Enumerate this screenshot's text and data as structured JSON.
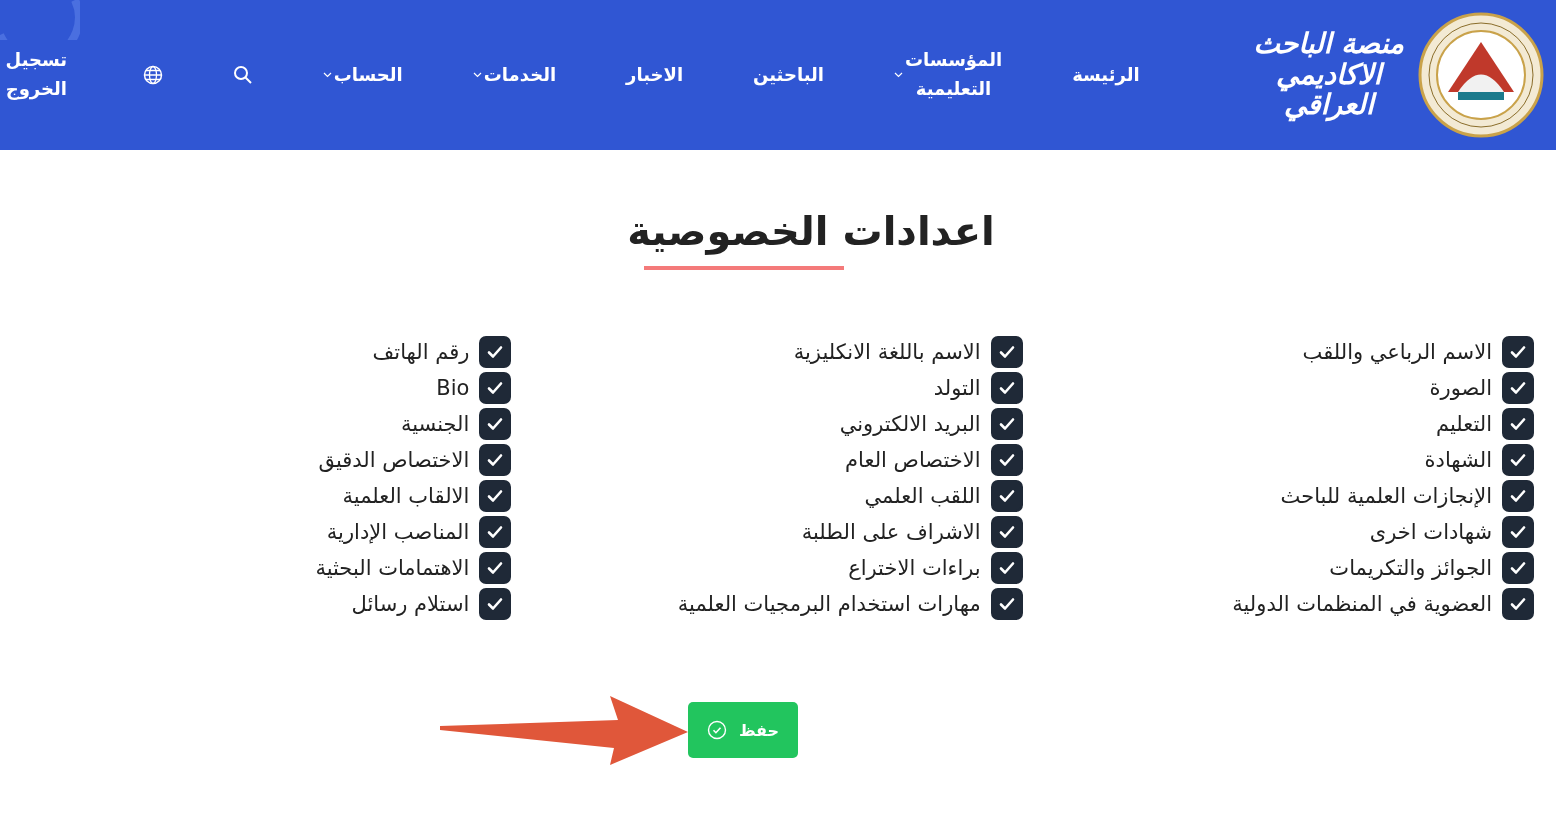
{
  "header": {
    "brand": [
      "منصة الباحث",
      "الاكاديمي",
      "العراقي"
    ],
    "nav": [
      {
        "kind": "link",
        "label": "الرئيسة"
      },
      {
        "kind": "dropdown",
        "label": "المؤسسات التعليمية"
      },
      {
        "kind": "link",
        "label": "الباحثين"
      },
      {
        "kind": "link",
        "label": "الاخبار"
      },
      {
        "kind": "dropdown",
        "label": "الخدمات"
      },
      {
        "kind": "dropdown",
        "label": "الحساب"
      },
      {
        "kind": "search"
      },
      {
        "kind": "language"
      },
      {
        "kind": "link",
        "label": "تسجيل الخروج"
      }
    ]
  },
  "page": {
    "title": "اعدادات الخصوصية",
    "columns": [
      [
        {
          "label": "الاسم الرباعي واللقب",
          "checked": true
        },
        {
          "label": "الصورة",
          "checked": true
        },
        {
          "label": "التعليم",
          "checked": true
        },
        {
          "label": "الشهادة",
          "checked": true
        },
        {
          "label": "الإنجازات العلمية للباحث",
          "checked": true
        },
        {
          "label": "شهادات اخرى",
          "checked": true
        },
        {
          "label": "الجوائز والتكريمات",
          "checked": true
        },
        {
          "label": "العضوية في المنظمات الدولية",
          "checked": true
        }
      ],
      [
        {
          "label": "الاسم باللغة الانكليزية",
          "checked": true
        },
        {
          "label": "التولد",
          "checked": true
        },
        {
          "label": "البريد الالكتروني",
          "checked": true
        },
        {
          "label": "الاختصاص العام",
          "checked": true
        },
        {
          "label": "اللقب العلمي",
          "checked": true
        },
        {
          "label": "الاشراف على الطلبة",
          "checked": true
        },
        {
          "label": "براءات الاختراع",
          "checked": true
        },
        {
          "label": "مهارات استخدام البرمجيات العلمية",
          "checked": true
        }
      ],
      [
        {
          "label": "رقم الهاتف",
          "checked": true
        },
        {
          "label": "Bio",
          "checked": true
        },
        {
          "label": "الجنسية",
          "checked": true
        },
        {
          "label": "الاختصاص الدقيق",
          "checked": true
        },
        {
          "label": "الالقاب العلمية",
          "checked": true
        },
        {
          "label": "المناصب الإدارية",
          "checked": true
        },
        {
          "label": "الاهتمامات البحثية",
          "checked": true
        },
        {
          "label": "استلام رسائل",
          "checked": true
        }
      ]
    ],
    "save_button": "حفظ"
  }
}
